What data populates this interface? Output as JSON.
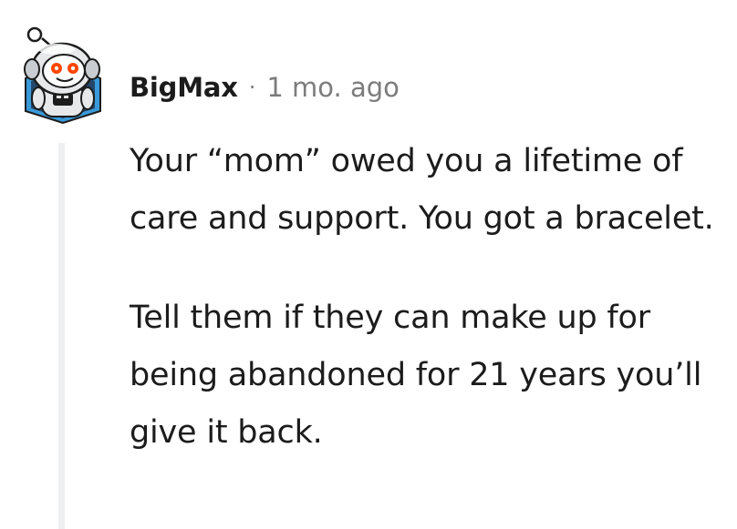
{
  "comment": {
    "author": "BigMax",
    "separator": "·",
    "timestamp": "1 mo. ago",
    "paragraphs": [
      "Your “mom” owed you a lifetime of care and support. You got a bracelet.",
      "Tell them if they can make up for being abandoned for 21 years you’ll give it back."
    ]
  },
  "icons": {
    "avatar": "snoo-astronaut-avatar-icon"
  },
  "colors": {
    "text": "#1c1c1c",
    "meta": "#7c7c7c",
    "thread_line": "#edeff1",
    "avatar_accent": "#ff4500"
  }
}
